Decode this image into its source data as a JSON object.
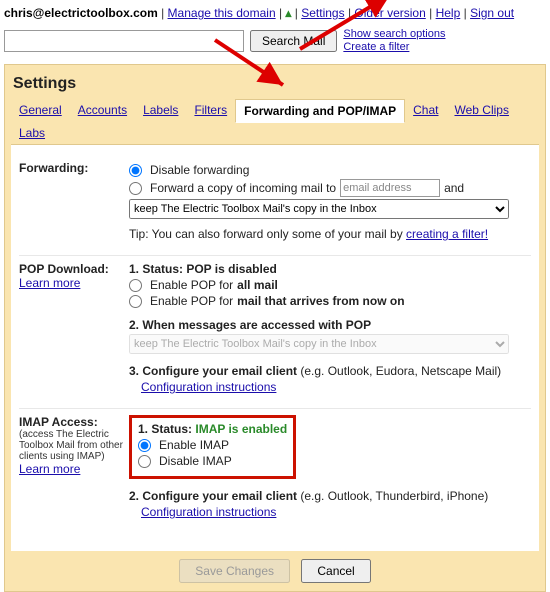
{
  "header": {
    "email": "chris@electrictoolbox.com",
    "manage": "Manage this domain",
    "settings": "Settings",
    "older": "Older version",
    "help": "Help",
    "signout": "Sign out"
  },
  "search": {
    "button": "Search Mail",
    "show_options": "Show search options",
    "create_filter": "Create a filter"
  },
  "title": "Settings",
  "tabs": {
    "general": "General",
    "accounts": "Accounts",
    "labels": "Labels",
    "filters": "Filters",
    "forwarding": "Forwarding and POP/IMAP",
    "chat": "Chat",
    "webclips": "Web Clips",
    "labs": "Labs"
  },
  "forwarding": {
    "label": "Forwarding:",
    "disable": "Disable forwarding",
    "forward_prefix": "Forward a copy of incoming mail to",
    "email_placeholder": "email address",
    "and": "and",
    "keep_option": "keep The Electric Toolbox Mail's copy in the Inbox",
    "tip_prefix": "Tip: You can also forward only some of your mail by ",
    "tip_link": "creating a filter!"
  },
  "pop": {
    "label": "POP Download:",
    "learn": "Learn more",
    "status_label": "1. Status: POP is disabled",
    "opt_all_prefix": "Enable POP for ",
    "opt_all_bold": "all mail",
    "opt_now_prefix": "Enable POP for ",
    "opt_now_bold": "mail that arrives from now on",
    "when": "2. When messages are accessed with POP",
    "when_option": "keep The Electric Toolbox Mail's copy in the Inbox",
    "configure_bold": "3. Configure your email client",
    "configure_rest": " (e.g. Outlook, Eudora, Netscape Mail)",
    "conf_link": "Configuration instructions"
  },
  "imap": {
    "label": "IMAP Access:",
    "sub": "(access The Electric Toolbox Mail from other clients using IMAP)",
    "learn": "Learn more",
    "status_prefix": "1. Status: ",
    "status_value": "IMAP is enabled",
    "enable": "Enable IMAP",
    "disable": "Disable IMAP",
    "configure_bold": "2. Configure your email client",
    "configure_rest": " (e.g. Outlook, Thunderbird, iPhone)",
    "conf_link": "Configuration instructions"
  },
  "buttons": {
    "save": "Save Changes",
    "cancel": "Cancel"
  }
}
